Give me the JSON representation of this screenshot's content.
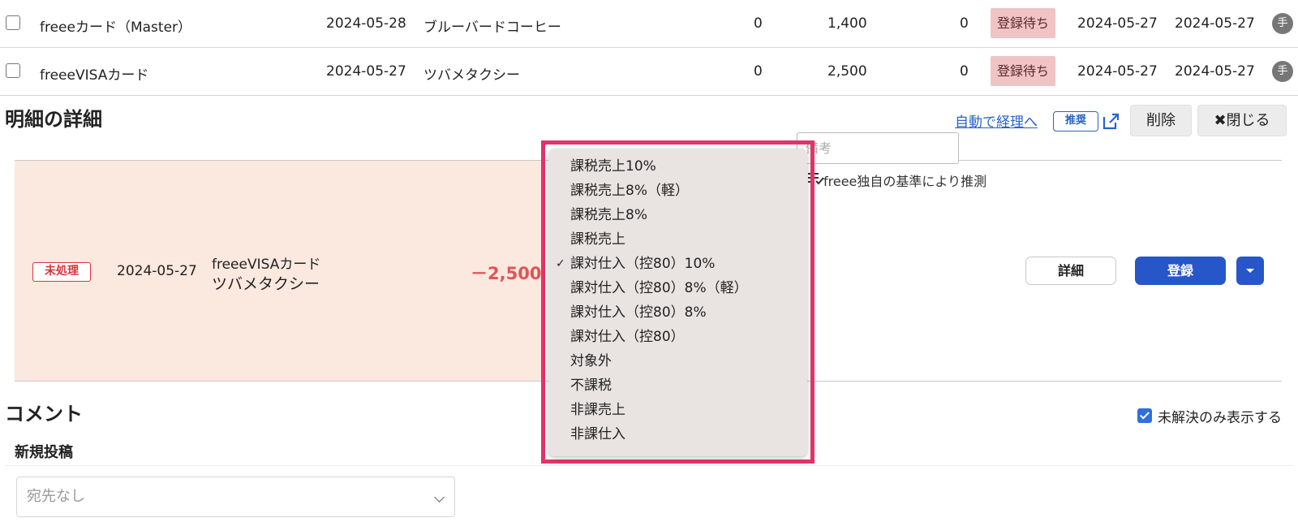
{
  "rows": [
    {
      "card": "freeeカード（Master）",
      "date": "2024-05-28",
      "vendor": "ブルーバードコーヒー",
      "income": "0",
      "expense": "1,400",
      "other": "0",
      "status": "登録待ち",
      "date2": "2024-05-27",
      "date3": "2024-05-27",
      "badge": "手"
    },
    {
      "card": "freeeVISAカード",
      "date": "2024-05-27",
      "vendor": "ツバメタクシー",
      "income": "0",
      "expense": "2,500",
      "other": "0",
      "status": "登録待ち",
      "date2": "2024-05-27",
      "date3": "2024-05-27",
      "badge": "手"
    }
  ],
  "detail": {
    "title": "明細の詳細",
    "auto_link": "自動で経理へ",
    "recommend": "推奨",
    "delete": "削除",
    "close": "閉じる",
    "close_icon": "✖",
    "status": "未処理",
    "date": "2024-05-27",
    "card": "freeeVISAカード",
    "vendor": "ツバメタクシー",
    "amount": "－2,500",
    "memo_placeholder": "備考",
    "guess": "freee独自の基準により推測",
    "detail_button": "詳細",
    "register_button": "登録"
  },
  "dropdown": {
    "selected_index": 4,
    "check": "✓",
    "items": [
      "課税売上10%",
      "課税売上8%（軽）",
      "課税売上8%",
      "課税売上",
      "課対仕入（控80）10%",
      "課対仕入（控80）8%（軽）",
      "課対仕入（控80）8%",
      "課対仕入（控80）",
      "対象外",
      "不課税",
      "非課売上",
      "非課仕入"
    ]
  },
  "comments": {
    "title": "コメント",
    "unresolved_label": "未解決のみ表示する",
    "unresolved_checked": true,
    "new_post": "新規投稿",
    "recipient_placeholder": "宛先なし"
  },
  "colors": {
    "accent": "#2756c8",
    "highlight": "#e4326a",
    "amount": "#e05555",
    "status_wait_bg": "#f0c4c4"
  }
}
